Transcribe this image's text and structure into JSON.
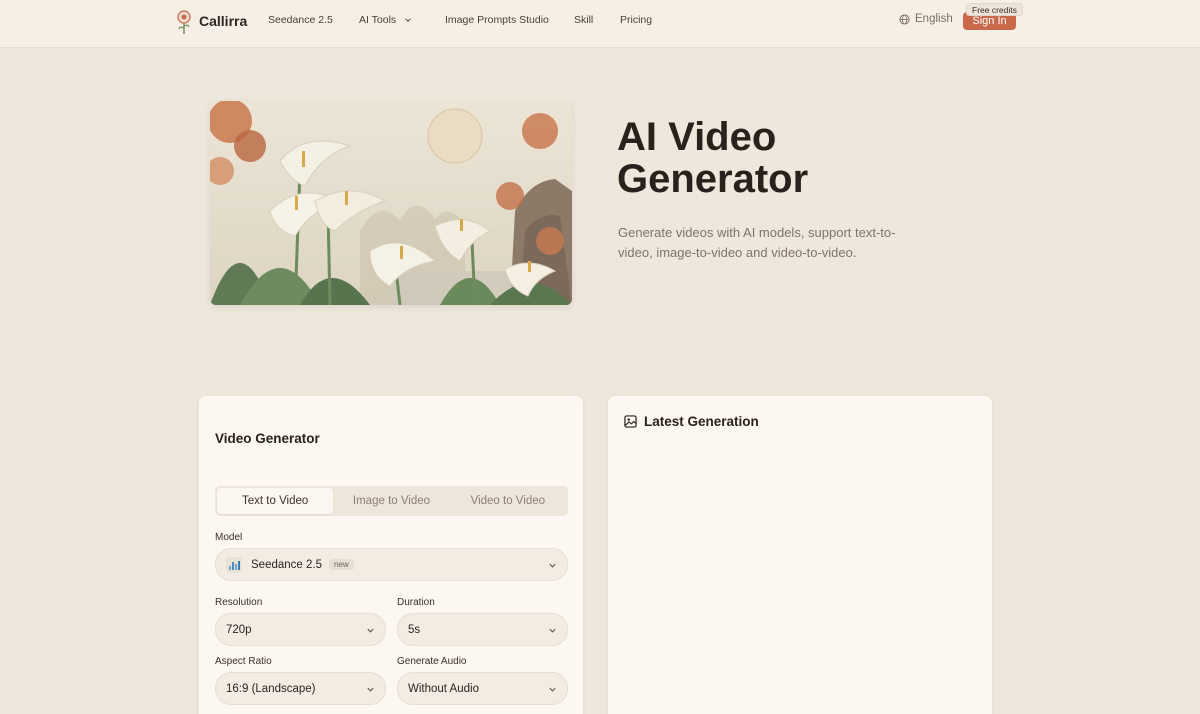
{
  "header": {
    "brand": "Callirra",
    "nav": [
      "Seedance 2.5",
      "AI Tools",
      "Image Prompts Studio",
      "Skill",
      "Pricing"
    ],
    "language": "English",
    "sign_in": "Sign In",
    "badge": "Free credits"
  },
  "hero": {
    "title": "AI Video Generator",
    "subtitle": "Generate videos with AI models, support text-to-video, image-to-video and video-to-video."
  },
  "generator": {
    "title": "Video Generator",
    "tabs": [
      "Text to Video",
      "Image to Video",
      "Video to Video"
    ],
    "active_tab": "Text to Video",
    "model_label": "Model",
    "model_value": "Seedance 2.5",
    "model_tag": "new",
    "resolution_label": "Resolution",
    "resolution_value": "720p",
    "duration_label": "Duration",
    "duration_value": "5s",
    "aspect_label": "Aspect Ratio",
    "aspect_value": "16:9 (Landscape)",
    "audio_label": "Generate Audio",
    "audio_value": "Without Audio"
  },
  "latest": {
    "title": "Latest Generation",
    "icon": "image-icon"
  },
  "colors": {
    "accent": "#c8694b",
    "background": "#efe6dc",
    "card": "#fcf7f0"
  }
}
